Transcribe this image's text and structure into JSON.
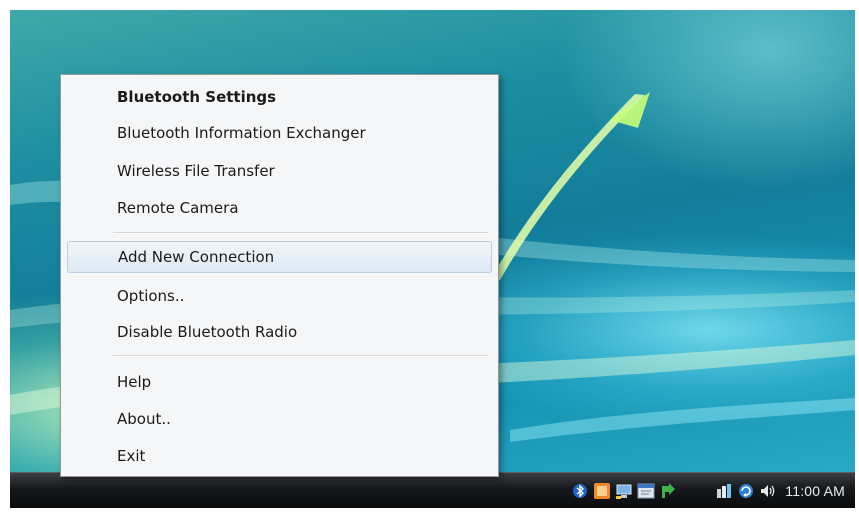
{
  "menu": {
    "items": [
      {
        "label": "Bluetooth Settings"
      },
      {
        "label": "Bluetooth Information Exchanger"
      },
      {
        "label": "Wireless File Transfer"
      },
      {
        "label": "Remote Camera"
      },
      {
        "label": "Add New Connection"
      },
      {
        "label": "Options.."
      },
      {
        "label": "Disable Bluetooth Radio"
      },
      {
        "label": "Help"
      },
      {
        "label": "About.."
      },
      {
        "label": "Exit"
      }
    ]
  },
  "taskbar": {
    "clock": "11:00 AM",
    "tray_icons": [
      "bluetooth-icon",
      "orange-app-icon",
      "network-monitor-icon",
      "message-window-icon",
      "green-arrow-icon",
      "network-connection-icon",
      "windows-update-icon",
      "speaker-icon"
    ]
  },
  "colors": {
    "menu_background": "#f5f6f7",
    "menu_highlight": "#dde9f4",
    "taskbar": "#15171a",
    "wallpaper_teal": "#137d9a"
  }
}
